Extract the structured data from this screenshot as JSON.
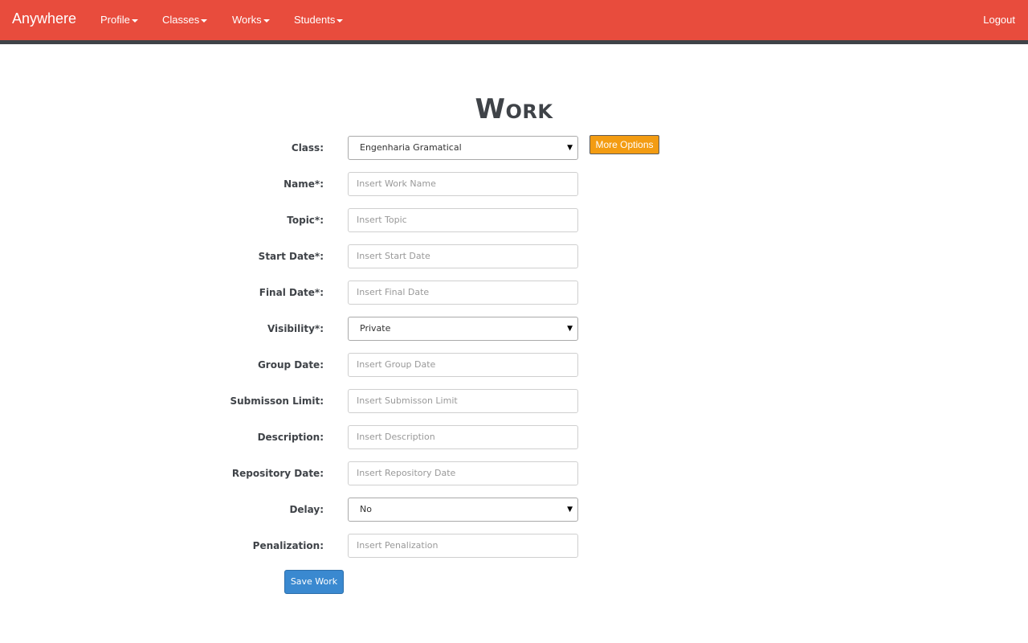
{
  "nav": {
    "brand": "Anywhere",
    "items": [
      {
        "label": "Profile"
      },
      {
        "label": "Classes"
      },
      {
        "label": "Works"
      },
      {
        "label": "Students"
      }
    ],
    "logout": "Logout"
  },
  "page": {
    "title": "Work"
  },
  "form": {
    "class_label": "Class:",
    "class_value": "Engenharia Gramatical",
    "more_options": "More Options",
    "name_label": "Name*:",
    "name_placeholder": "Insert Work Name",
    "topic_label": "Topic*:",
    "topic_placeholder": "Insert Topic",
    "start_date_label": "Start Date*:",
    "start_date_placeholder": "Insert Start Date",
    "final_date_label": "Final Date*:",
    "final_date_placeholder": "Insert Final Date",
    "visibility_label": "Visibility*:",
    "visibility_value": "Private",
    "group_date_label": "Group Date:",
    "group_date_placeholder": "Insert Group Date",
    "submission_limit_label": "Submisson Limit:",
    "submission_limit_placeholder": "Insert Submisson Limit",
    "description_label": "Description:",
    "description_placeholder": "Insert Description",
    "repository_date_label": "Repository Date:",
    "repository_date_placeholder": "Insert Repository Date",
    "delay_label": "Delay:",
    "delay_value": "No",
    "penalization_label": "Penalization:",
    "penalization_placeholder": "Insert Penalization",
    "save_label": "Save Work"
  },
  "colors": {
    "navbar": "#e84c3d",
    "navbar_border": "#3f4348",
    "more_options_button": "#f39c12",
    "save_button": "#3a89d0"
  },
  "icons": {
    "dropdown_caret": "caret-down-icon",
    "select_arrow": "select-arrow-icon"
  }
}
